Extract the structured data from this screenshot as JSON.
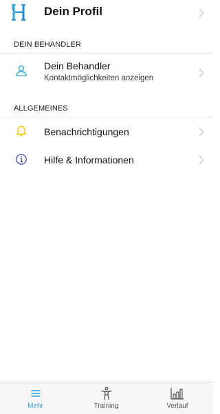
{
  "profile": {
    "title": "Dein Profil",
    "logo_icon": "h-logo-icon",
    "chevron_icon": "chevron-right-icon"
  },
  "sections": {
    "behandler": {
      "header": "DEIN BEHANDLER",
      "row": {
        "icon": "person-icon",
        "title": "Dein Behandler",
        "subtitle": "Kontaktmöglichkeiten anzeigen"
      }
    },
    "allgemeines": {
      "header": "ALLGEMEINES",
      "rows": [
        {
          "icon": "bell-icon",
          "title": "Benachrichtigungen"
        },
        {
          "icon": "info-icon",
          "title": "Hilfe & Informationen"
        }
      ]
    }
  },
  "tabbar": {
    "tabs": [
      {
        "icon": "menu-icon",
        "label": "Mehr",
        "active": true
      },
      {
        "icon": "figure-icon",
        "label": "Training",
        "active": false
      },
      {
        "icon": "bar-chart-icon",
        "label": "Verlauf",
        "active": false
      }
    ]
  },
  "colors": {
    "accent": "#27a0dc",
    "bell": "#f5c400",
    "info": "#3a3fc4",
    "chevron": "#c4c4c4"
  }
}
